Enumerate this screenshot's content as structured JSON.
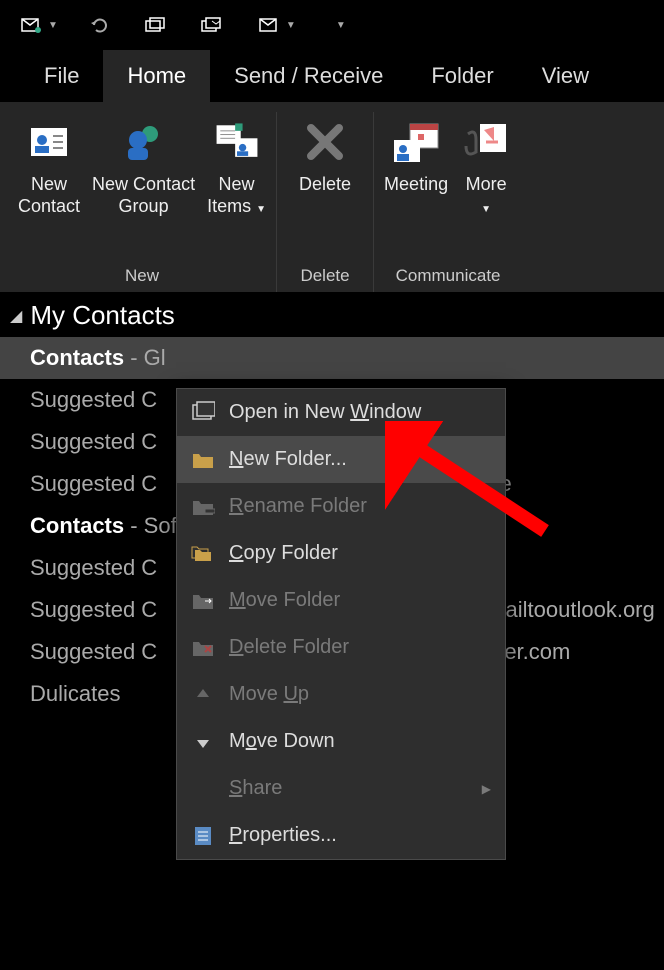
{
  "qat": [
    {
      "name": "send-receive-qat-icon"
    },
    {
      "name": "undo-qat-icon"
    },
    {
      "name": "folder-qat-icon"
    },
    {
      "name": "print-qat-icon"
    },
    {
      "name": "folder2-qat-icon"
    }
  ],
  "tabs": [
    {
      "label": "File",
      "active": false
    },
    {
      "label": "Home",
      "active": true
    },
    {
      "label": "Send / Receive",
      "active": false
    },
    {
      "label": "Folder",
      "active": false
    },
    {
      "label": "View",
      "active": false
    }
  ],
  "ribbon": {
    "groups": [
      {
        "label": "New",
        "buttons": [
          {
            "label1": "New",
            "label2": "Contact",
            "name": "new-contact-button"
          },
          {
            "label1": "New Contact",
            "label2": "Group",
            "name": "new-contact-group-button"
          },
          {
            "label1": "New",
            "label2": "Items ",
            "drop": true,
            "name": "new-items-button"
          }
        ]
      },
      {
        "label": "Delete",
        "buttons": [
          {
            "label1": "Delete",
            "label2": "",
            "name": "delete-button"
          }
        ]
      },
      {
        "label": "Communicate",
        "buttons": [
          {
            "label1": "Meeting",
            "label2": "",
            "name": "meeting-button"
          },
          {
            "label1": "More",
            "label2": "",
            "drop": true,
            "name": "more-button"
          }
        ]
      }
    ]
  },
  "nav": {
    "header": "My Contacts",
    "items": [
      {
        "bold": "Contacts",
        "suffix": " - Gl",
        "selected": true
      },
      {
        "bold": "",
        "suffix": "Suggested C"
      },
      {
        "bold": "",
        "suffix": "Suggested C"
      },
      {
        "bold": "",
        "suffix": "Suggested C",
        "after": "ne"
      },
      {
        "bold": "Contacts",
        "suffix": " - Sof"
      },
      {
        "bold": "",
        "suffix": "Suggested C"
      },
      {
        "bold": "",
        "suffix": "Suggested C",
        "after": "mailtooutlook.org"
      },
      {
        "bold": "",
        "suffix": "Suggested C",
        "after": "sfer.com"
      },
      {
        "bold": "",
        "suffix": "Dulicates"
      }
    ]
  },
  "context_menu": [
    {
      "label": "Open in New Window",
      "underline": "W",
      "name": "open-new-window-menu-item",
      "icon": "window"
    },
    {
      "label": "New Folder...",
      "underline": "N",
      "name": "new-folder-menu-item",
      "icon": "folder",
      "hover": true
    },
    {
      "label": "Rename Folder",
      "underline": "R",
      "name": "rename-folder-menu-item",
      "icon": "folder-rename",
      "disabled": true
    },
    {
      "label": "Copy Folder",
      "underline": "C",
      "name": "copy-folder-menu-item",
      "icon": "folder-copy"
    },
    {
      "label": "Move Folder",
      "underline": "M",
      "name": "move-folder-menu-item",
      "icon": "folder-move",
      "disabled": true
    },
    {
      "label": "Delete Folder",
      "underline": "D",
      "name": "delete-folder-menu-item",
      "icon": "folder-delete",
      "disabled": true
    },
    {
      "label": "Move Up",
      "underline": "U",
      "name": "move-up-menu-item",
      "icon": "up",
      "disabled": true
    },
    {
      "label": "Move Down",
      "underline": "o",
      "name": "move-down-menu-item",
      "icon": "down"
    },
    {
      "label": "Share",
      "underline": "S",
      "name": "share-menu-item",
      "submenu": true,
      "disabled": true
    },
    {
      "label": "Properties...",
      "underline": "P",
      "name": "properties-menu-item",
      "icon": "props"
    }
  ]
}
